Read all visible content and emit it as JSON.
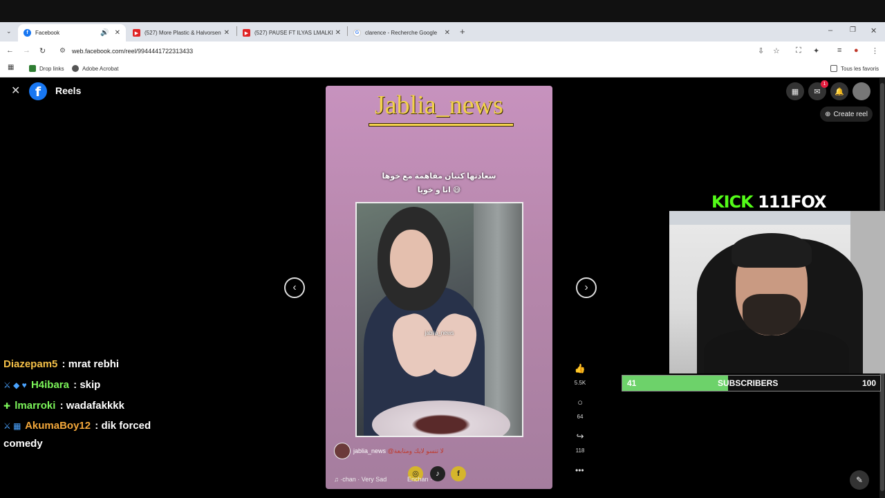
{
  "browser": {
    "tabs": [
      {
        "title": "Facebook",
        "favicon_color": "#1877f2",
        "favicon_glyph": "f",
        "audio": true
      },
      {
        "title": "(527) More Plastic & Halvorsen",
        "favicon_color": "#e02424",
        "favicon_glyph": "▶"
      },
      {
        "title": "(527) PAUSE FT ILYAS LMALKI -",
        "favicon_color": "#e02424",
        "favicon_glyph": "▶"
      },
      {
        "title": "clarence - Recherche Google",
        "favicon_color": "#4285f4",
        "favicon_glyph": "G"
      }
    ],
    "new_tab": "+",
    "window_controls": {
      "minimize": "–",
      "restore": "❐",
      "close": "✕"
    },
    "url": "web.facebook.com/reel/9944441722313433",
    "bookmarks": [
      {
        "label": "Drop links",
        "color": "#2e7d32"
      },
      {
        "label": "Adobe Acrobat",
        "color": "#555"
      }
    ],
    "all_bookmarks": "Tous les favoris"
  },
  "facebook": {
    "header_title": "Reels",
    "logo_glyph": "f",
    "notification_count": "1",
    "create_reel": "Create reel"
  },
  "reel": {
    "overlay_title": "Jablia_news",
    "caption_line1": "سعادتها كتبان مفاهمة مع خوها",
    "caption_line2": "انا و خويا 😅",
    "watermark": "jablia_news",
    "author": "jablia_news",
    "author_caption": "@لا تنسو لايك ومتابعة",
    "music_left": "·chan · Very Sad",
    "music_right": "Enchan ·",
    "likes": "5.5K",
    "comments": "64",
    "shares": "118",
    "more": "•••",
    "prev": "‹",
    "next": "›"
  },
  "stream": {
    "kick_label": "KICK",
    "kick_name": "111FOX",
    "sub_goal_current": "41",
    "sub_goal_label": "SUBSCRIBERS",
    "sub_goal_target": "100",
    "sub_goal_progress": 0.41
  },
  "chat": [
    {
      "user": "Diazepam5",
      "color": "#f4c048",
      "badges": "",
      "message": ": mrat rebhi"
    },
    {
      "user": "H4ibara",
      "color": "#7cf55a",
      "badges": "⚔ ◆ ♥",
      "message": ": skip"
    },
    {
      "user": "lmarroki",
      "color": "#7cf55a",
      "badges": "✚",
      "message": ": wadafakkkk"
    },
    {
      "user": "AkumaBoy12",
      "color": "#f4a83b",
      "badges": "⚔ ▦",
      "message": ": dik forced"
    }
  ],
  "chat_continuation": "comedy"
}
